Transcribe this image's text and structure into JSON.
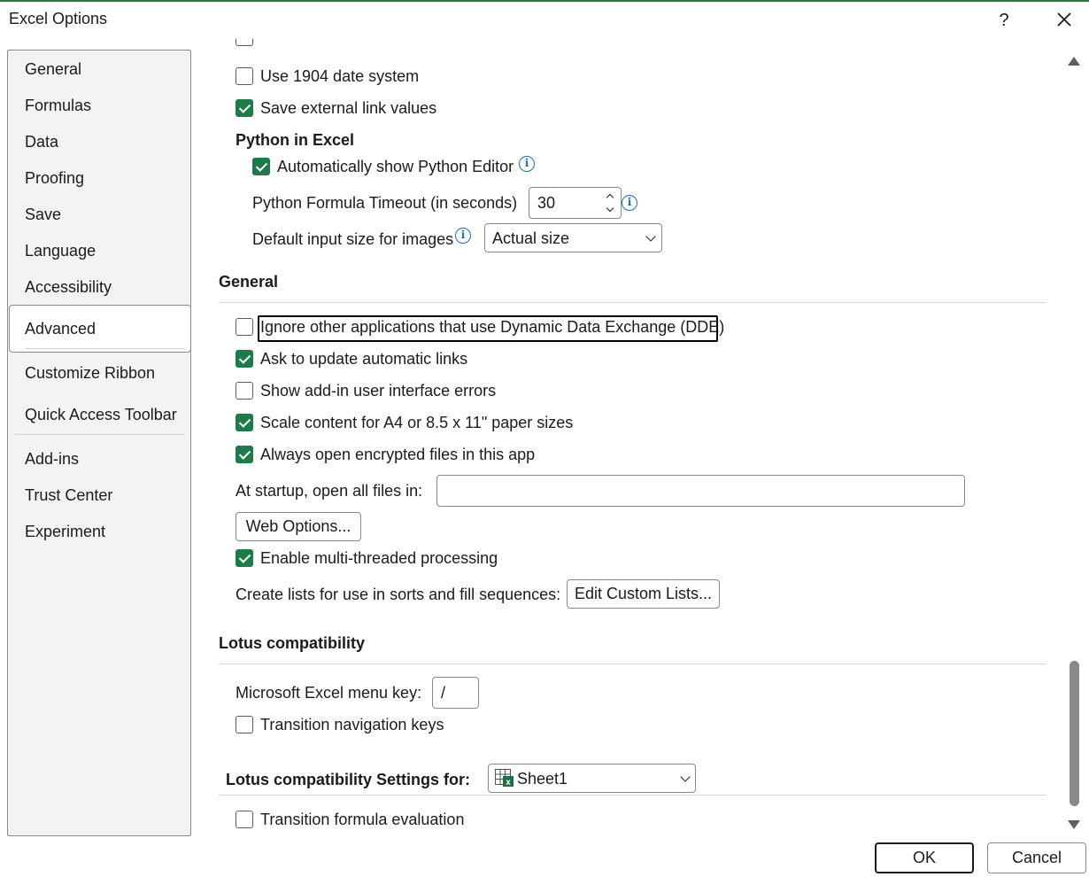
{
  "window": {
    "title": "Excel Options",
    "help_label": "?",
    "accent_color": "#1e7e44"
  },
  "sidebar": {
    "items": [
      {
        "label": "General"
      },
      {
        "label": "Formulas"
      },
      {
        "label": "Data"
      },
      {
        "label": "Proofing"
      },
      {
        "label": "Save"
      },
      {
        "label": "Language"
      },
      {
        "label": "Accessibility"
      },
      {
        "label": "Advanced",
        "selected": true
      },
      {
        "label": "Customize Ribbon"
      },
      {
        "label": "Quick Access Toolbar"
      },
      {
        "label": "Add-ins"
      },
      {
        "label": "Trust Center"
      },
      {
        "label": "Experiment"
      }
    ]
  },
  "content": {
    "date_system": {
      "label": "Use 1904 date system",
      "checked": false
    },
    "save_links": {
      "label": "Save external link values",
      "checked": true
    },
    "python": {
      "heading": "Python in Excel",
      "auto_editor": {
        "label": "Automatically show Python Editor",
        "checked": true
      },
      "timeout": {
        "label": "Python Formula Timeout (in seconds)",
        "value": "30"
      },
      "image_size": {
        "label": "Default input size for images",
        "value": "Actual size"
      }
    },
    "general": {
      "heading": "General",
      "ignore_dde": {
        "label": "Ignore other applications that use Dynamic Data Exchange (DDE)",
        "checked": false
      },
      "ask_update": {
        "label": "Ask to update automatic links",
        "checked": true
      },
      "addin_errors": {
        "label": "Show add-in user interface errors",
        "checked": false
      },
      "scale_content": {
        "label": "Scale content for A4 or 8.5 x 11\" paper sizes",
        "checked": true
      },
      "encrypted": {
        "label": "Always open encrypted files in this app",
        "checked": true
      },
      "startup": {
        "label": "At startup, open all files in:",
        "value": ""
      },
      "web_options": "Web Options...",
      "multithread": {
        "label": "Enable multi-threaded processing",
        "checked": true
      },
      "lists": {
        "label": "Create lists for use in sorts and fill sequences:",
        "button": "Edit Custom Lists..."
      }
    },
    "lotus": {
      "heading": "Lotus compatibility",
      "menu_key": {
        "label": "Microsoft Excel menu key:",
        "value": "/"
      },
      "nav_keys": {
        "label": "Transition navigation keys",
        "checked": false
      }
    },
    "lotus_settings": {
      "heading": "Lotus compatibility Settings for:",
      "sheet": "Sheet1",
      "formula_eval": {
        "label": "Transition formula evaluation",
        "checked": false
      }
    }
  },
  "footer": {
    "ok": "OK",
    "cancel": "Cancel"
  },
  "colors": {
    "checkbox": "#1f7a4a",
    "info_icon": "#1a6fb8",
    "sheet_icon": "#1d6f42"
  }
}
